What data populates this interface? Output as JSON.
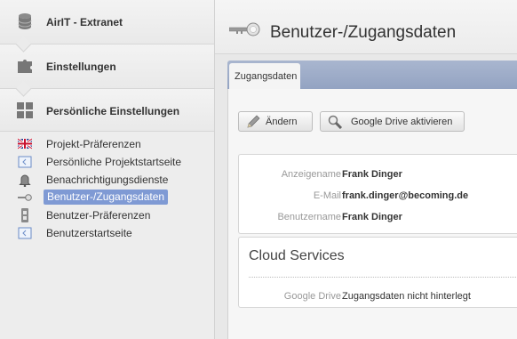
{
  "sidebar": {
    "sections": [
      {
        "label": "AirIT - Extranet",
        "icon": "database-icon"
      },
      {
        "label": "Einstellungen",
        "icon": "puzzle-piece-icon"
      },
      {
        "label": "Persönliche Einstellungen",
        "icon": "grid-icon"
      }
    ],
    "items": [
      {
        "label": "Projekt-Präferenzen",
        "icon": "uk-flag-icon"
      },
      {
        "label": "Persönliche Projektstartseite",
        "icon": "window-icon"
      },
      {
        "label": "Benachrichtigungsdienste",
        "icon": "bell-icon"
      },
      {
        "label": "Benutzer-/Zugangsdaten",
        "icon": "key-icon",
        "active": true
      },
      {
        "label": "Benutzer-Präferenzen",
        "icon": "settings-switch-icon"
      },
      {
        "label": "Benutzerstartseite",
        "icon": "window-icon"
      }
    ]
  },
  "header": {
    "title": "Benutzer-/Zugangsdaten",
    "icon": "key-icon"
  },
  "tabs": [
    {
      "label": "Zugangsdaten",
      "active": true
    }
  ],
  "toolbar": {
    "edit_label": "Ändern",
    "gdrive_label": "Google Drive aktivieren"
  },
  "user_info": {
    "rows": [
      {
        "label": "Anzeigename",
        "value": "Frank Dinger"
      },
      {
        "label": "E-Mail",
        "value": "frank.dinger@becoming.de"
      },
      {
        "label": "Benutzername",
        "value": "Frank Dinger"
      }
    ]
  },
  "cloud": {
    "title": "Cloud Services",
    "row": {
      "label": "Google Drive",
      "value": "Zugangsdaten nicht hinterlegt"
    }
  },
  "colors": {
    "active_item": "#7f9ad4",
    "tabbar": "#9daac6"
  }
}
